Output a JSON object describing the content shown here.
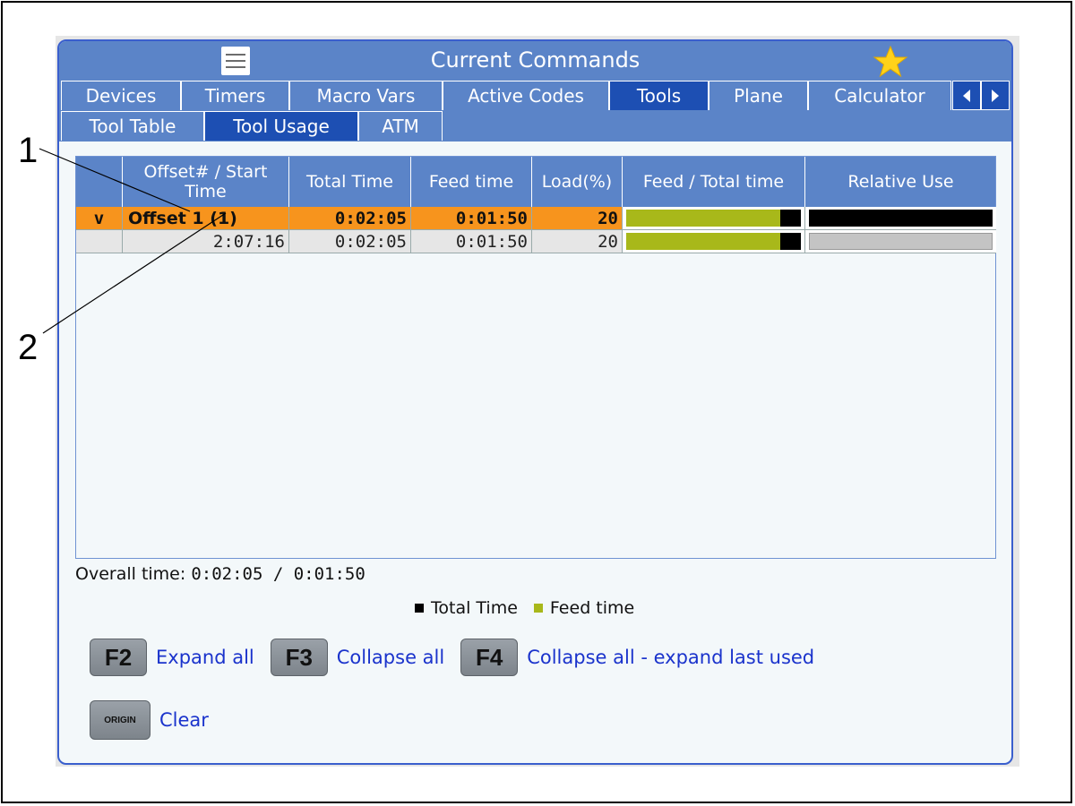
{
  "window": {
    "title": "Current Commands"
  },
  "tabs": [
    {
      "label": "Devices"
    },
    {
      "label": "Timers"
    },
    {
      "label": "Macro Vars"
    },
    {
      "label": "Active Codes"
    },
    {
      "label": "Tools"
    },
    {
      "label": "Plane"
    },
    {
      "label": "Calculator"
    }
  ],
  "subtabs": [
    {
      "label": "Tool Table"
    },
    {
      "label": "Tool Usage"
    },
    {
      "label": "ATM"
    }
  ],
  "table": {
    "headers": [
      "",
      "Offset# / Start Time",
      "Total Time",
      "Feed time",
      "Load(%)",
      "Feed / Total time",
      "Relative Use"
    ],
    "rows": [
      {
        "expander": "v",
        "offset": "Offset 1 (1)",
        "total": "0:02:05",
        "feed": "0:01:50",
        "load": "20",
        "feed_ratio": 0.88,
        "relative_use": 1.0
      },
      {
        "expander": "",
        "offset": "2:07:16",
        "total": "0:02:05",
        "feed": "0:01:50",
        "load": "20",
        "feed_ratio": 0.88,
        "relative_use": 1.0
      }
    ]
  },
  "overall": {
    "label": "Overall time:",
    "value": "0:02:05 /  0:01:50"
  },
  "legend": [
    {
      "label": "Total Time",
      "color": "#000000"
    },
    {
      "label": "Feed time",
      "color": "#a8b81a"
    }
  ],
  "fkeys": [
    {
      "key": "F2",
      "label": "Expand all"
    },
    {
      "key": "F3",
      "label": "Collapse all"
    },
    {
      "key": "F4",
      "label": "Collapse all - expand last used"
    }
  ],
  "origin": {
    "key": "ORIGIN",
    "label": "Clear"
  },
  "callouts": [
    "1",
    "2"
  ],
  "colors": {
    "header_blue": "#5b84c8",
    "active_tab": "#1d4fb3",
    "selected_row": "#f7941d",
    "feed_bar": "#a8b81a"
  },
  "icons": {
    "menu": "hamburger-menu-icon",
    "favorite": "star-icon",
    "scroll_left": "arrow-left-icon",
    "scroll_right": "arrow-right-icon"
  }
}
